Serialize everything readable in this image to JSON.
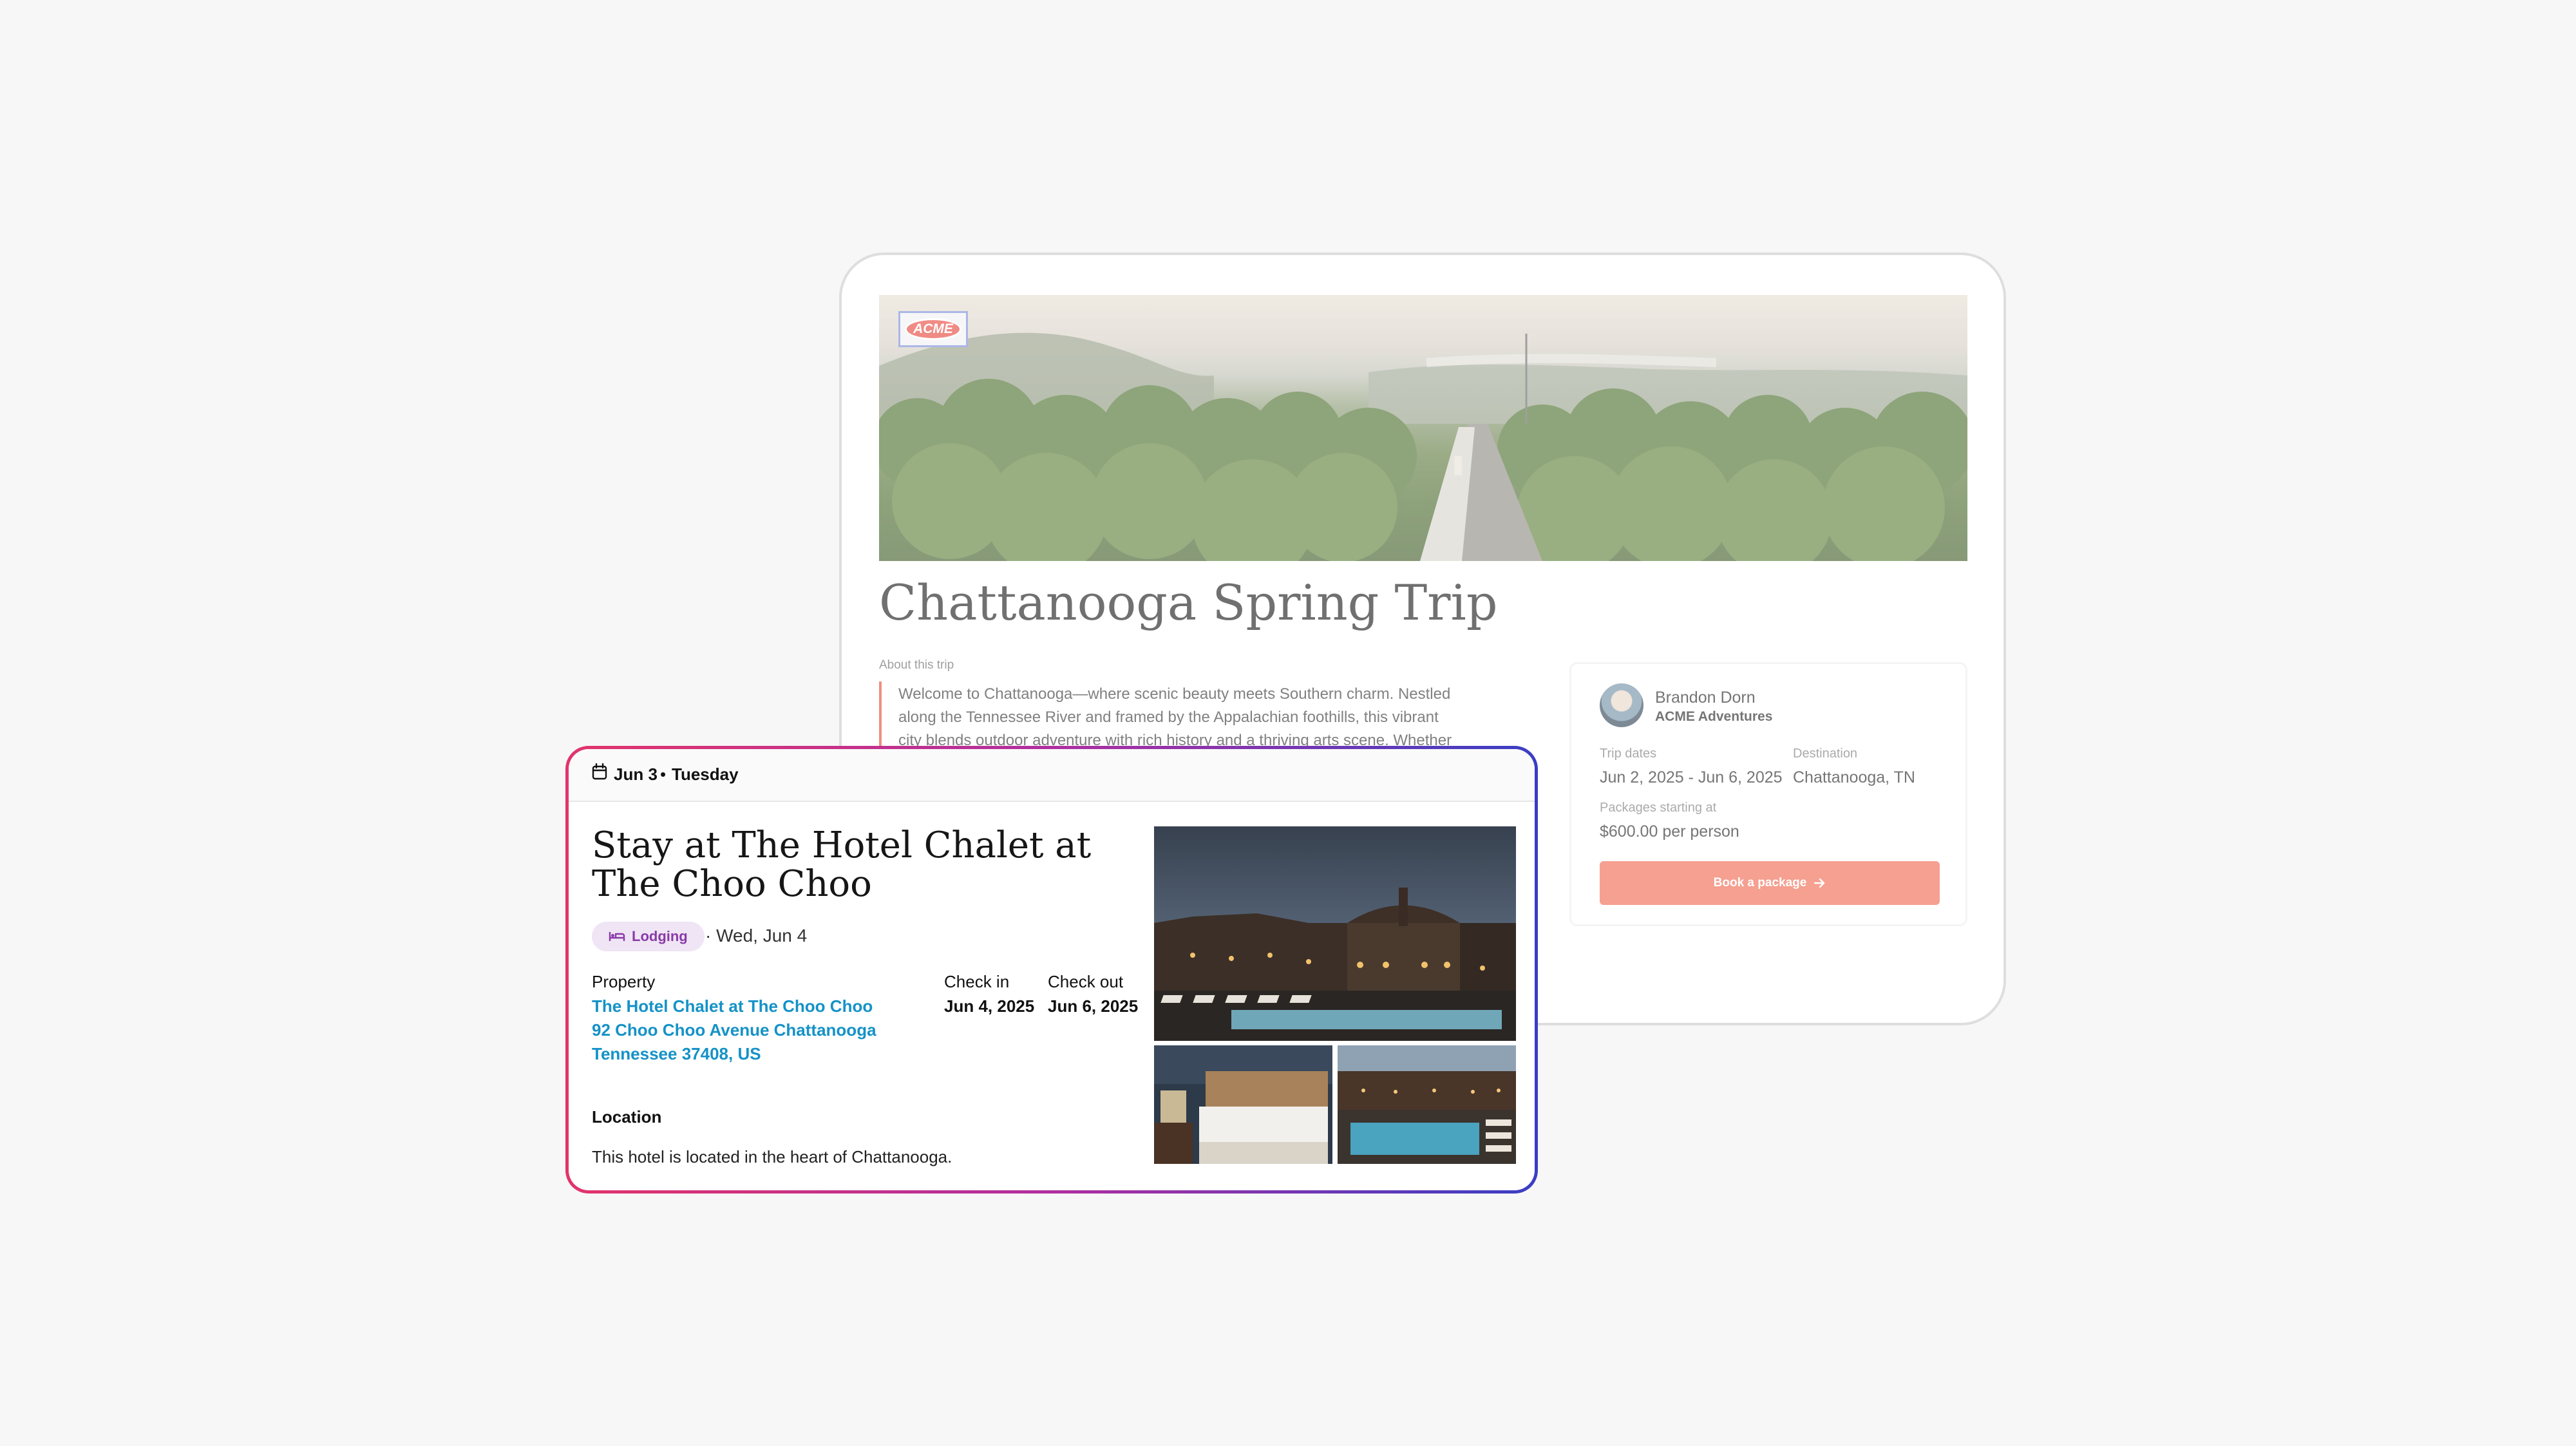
{
  "trip": {
    "logo_text": "ACME",
    "title": "Chattanooga Spring Trip",
    "about_label": "About this trip",
    "about_lines": [
      "Welcome to Chattanooga—where scenic beauty meets Southern charm. Nestled",
      "along the Tennessee River and framed by the Appalachian foothills, this vibrant",
      "city blends outdoor adventure with rich history and a thriving arts scene. Whether"
    ],
    "host": {
      "name": "Brandon Dorn",
      "org": "ACME Adventures"
    },
    "trip_dates_label": "Trip dates",
    "trip_dates": "Jun 2, 2025 - Jun 6, 2025",
    "destination_label": "Destination",
    "destination": "Chattanooga, TN",
    "packages_label": "Packages starting at",
    "packages_price": "$600.00 per person",
    "book_button": "Book a package",
    "accent_color": "#f0674d"
  },
  "lodging": {
    "day_date": "Jun 3",
    "day_separator": "•",
    "day_name": "Tuesday",
    "title": "Stay at The Hotel Chalet at The Choo Choo",
    "tag": "Lodging",
    "tag_date": "· Wed, Jun 4",
    "property_label": "Property",
    "property_lines": [
      "The Hotel Chalet at The Choo Choo",
      "92 Choo Choo Avenue Chattanooga",
      "Tennessee 37408, US"
    ],
    "check_in_label": "Check in",
    "check_in": "Jun 4, 2025",
    "check_out_label": "Check out",
    "check_out": "Jun 6, 2025",
    "location_label": "Location",
    "location_text": "This hotel is located in the heart of Chattanooga.",
    "link_color": "#1592c7",
    "border_gradient": [
      "#e2346b",
      "#b02fa0",
      "#3a3ec4"
    ],
    "photos": [
      "hotel-exterior-pool-night",
      "hotel-room-bed",
      "hotel-pool-terrace"
    ]
  }
}
